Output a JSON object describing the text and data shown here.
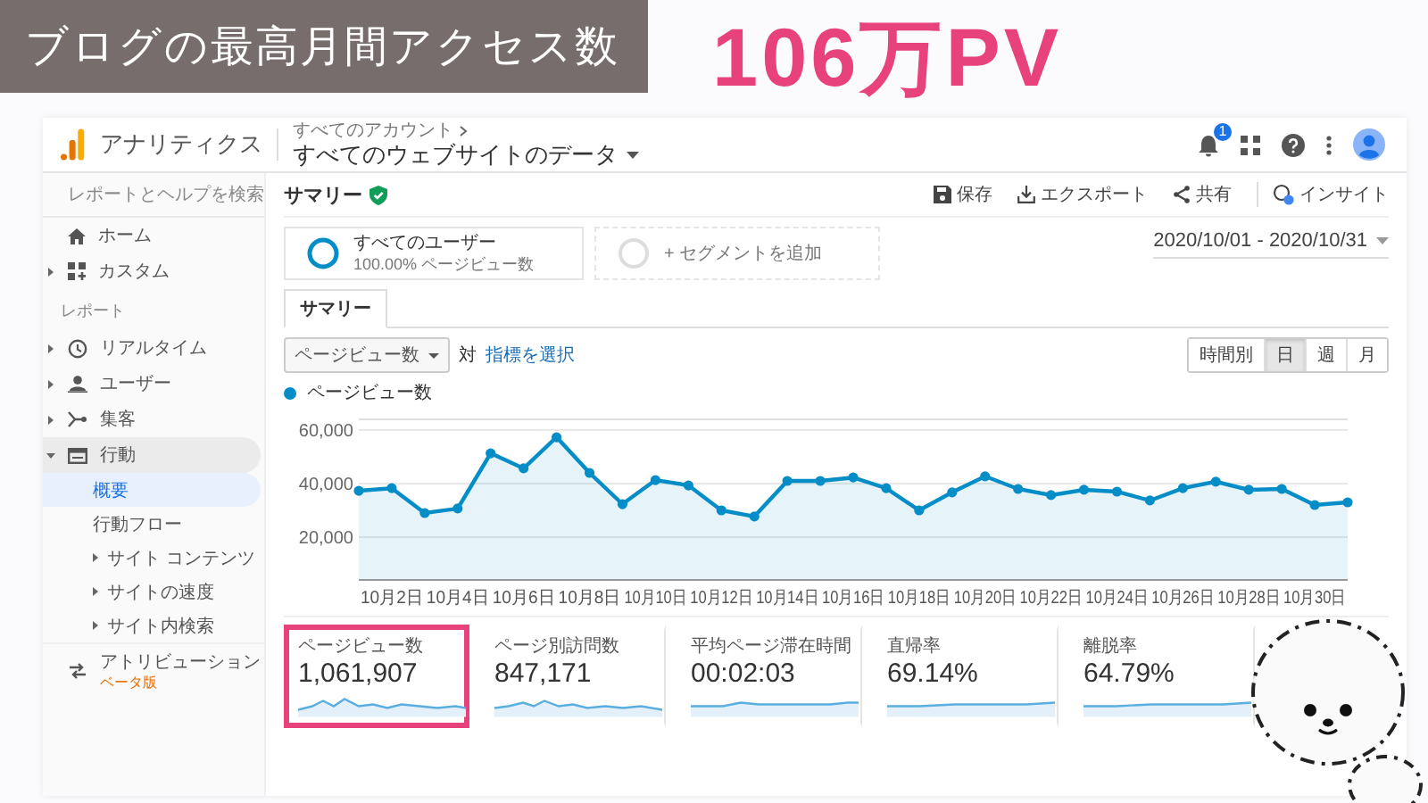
{
  "banner": {
    "caption": "ブログの最高月間アクセス数",
    "headline": "106万PV"
  },
  "app": {
    "product": "アナリティクス",
    "breadcrumb": "すべてのアカウント",
    "property": "すべてのウェブサイトのデータ",
    "notification_count": "1"
  },
  "sidebar": {
    "search_placeholder": "レポートとヘルプを検索",
    "items": [
      {
        "label": "ホーム",
        "kind": "link"
      },
      {
        "label": "カスタム",
        "kind": "group",
        "expanded": false
      }
    ],
    "section": "レポート",
    "reports": [
      {
        "label": "リアルタイム",
        "expanded": false
      },
      {
        "label": "ユーザー",
        "expanded": false
      },
      {
        "label": "集客",
        "expanded": false
      },
      {
        "label": "行動",
        "expanded": true,
        "children": [
          {
            "label": "概要",
            "kind": "link",
            "selected": true
          },
          {
            "label": "行動フロー",
            "kind": "link",
            "selected": false
          },
          {
            "label": "サイト コンテンツ",
            "kind": "group",
            "selected": false
          },
          {
            "label": "サイトの速度",
            "kind": "group",
            "selected": false
          },
          {
            "label": "サイト内検索",
            "kind": "group",
            "selected": false
          }
        ]
      }
    ],
    "attribution": {
      "label": "アトリビューション",
      "badge": "ベータ版"
    }
  },
  "main": {
    "title": "サマリー",
    "actions": [
      "保存",
      "エクスポート",
      "共有",
      "インサイト"
    ],
    "segments": [
      {
        "kind": "active",
        "name": "すべてのユーザー",
        "detail": "100.00% ページビュー数"
      },
      {
        "kind": "add",
        "name": "+ セグメントを追加"
      }
    ],
    "date_range": "2020/10/01 - 2020/10/31",
    "tabs": [
      {
        "label": "サマリー",
        "selected": true
      }
    ],
    "metric_select": "ページビュー数",
    "versus": "対",
    "choose_metric": "指標を選択",
    "granularity": [
      {
        "label": "時間別",
        "selected": false
      },
      {
        "label": "日",
        "selected": true
      },
      {
        "label": "週",
        "selected": false
      },
      {
        "label": "月",
        "selected": false
      }
    ],
    "chart": {
      "chart_data": {
        "type": "area",
        "categories": [
          null,
          "10月2日",
          null,
          "10月4日",
          null,
          "10月6日",
          null,
          "10月8日",
          null,
          "10月10日",
          null,
          "10月12日",
          null,
          "10月14日",
          null,
          "10月16日",
          null,
          "10月18日",
          null,
          "10月20日",
          null,
          "10月22日",
          null,
          "10月24日",
          null,
          "10月26日",
          null,
          "10月28日",
          null,
          "10月30日",
          null
        ],
        "series": [
          {
            "name": "ページビュー数",
            "color": "#058dc7",
            "values": [
              37300,
              38300,
              29000,
              30700,
              51300,
              45700,
              57300,
              44000,
              32300,
              41300,
              39300,
              30000,
              27700,
              41000,
              41000,
              42300,
              38300,
              30000,
              36700,
              42700,
              38000,
              35700,
              37700,
              37000,
              33700,
              38300,
              40700,
              37700,
              38000,
              32000,
              33000
            ]
          }
        ],
        "ylim": [
          4000,
          64000
        ],
        "grid": true,
        "yticks": [
          {
            "value": 20000,
            "label": "20,000"
          },
          {
            "value": 40000,
            "label": "40,000"
          },
          {
            "value": 60000,
            "label": "60,000"
          }
        ]
      }
    },
    "metrics": [
      {
        "label": "ページビュー数",
        "value": "1,061,907",
        "highlighted": true
      },
      {
        "label": "ページ別訪問数",
        "value": "847,171",
        "highlighted": false
      },
      {
        "label": "平均ページ滞在時間",
        "value": "00:02:03",
        "highlighted": false
      },
      {
        "label": "直帰率",
        "value": "69.14%",
        "highlighted": false
      },
      {
        "label": "離脱率",
        "value": "64.79%",
        "highlighted": false
      }
    ]
  }
}
